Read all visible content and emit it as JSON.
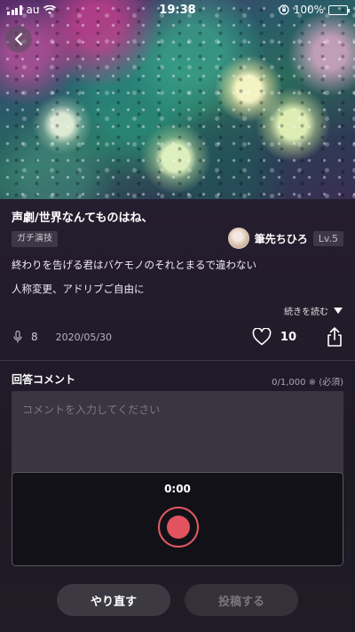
{
  "status_bar": {
    "carrier": "au",
    "time": "19:38",
    "battery": "100%"
  },
  "post": {
    "title": "声劇/世界なんてものはね、",
    "tag": "ガチ演技",
    "author_name": "筆先ちひろ",
    "author_level": "Lv.5",
    "description_line1": "終わりを告げる君はバケモノのそれとまるで違わない",
    "description_line2": "人称変更、アドリブご自由に",
    "read_more": "続きを読む",
    "mic_count": "8",
    "date": "2020/05/30",
    "like_count": "10"
  },
  "comment": {
    "label": "回答コメント",
    "counter": "0/1,000 ※ (必須)",
    "placeholder": "コメントを入力してください",
    "value": ""
  },
  "recorder": {
    "time": "0:00"
  },
  "buttons": {
    "redo": "やり直す",
    "post": "投稿する"
  },
  "colors": {
    "record_red": "#e2535f",
    "battery_green": "#4cd964"
  }
}
